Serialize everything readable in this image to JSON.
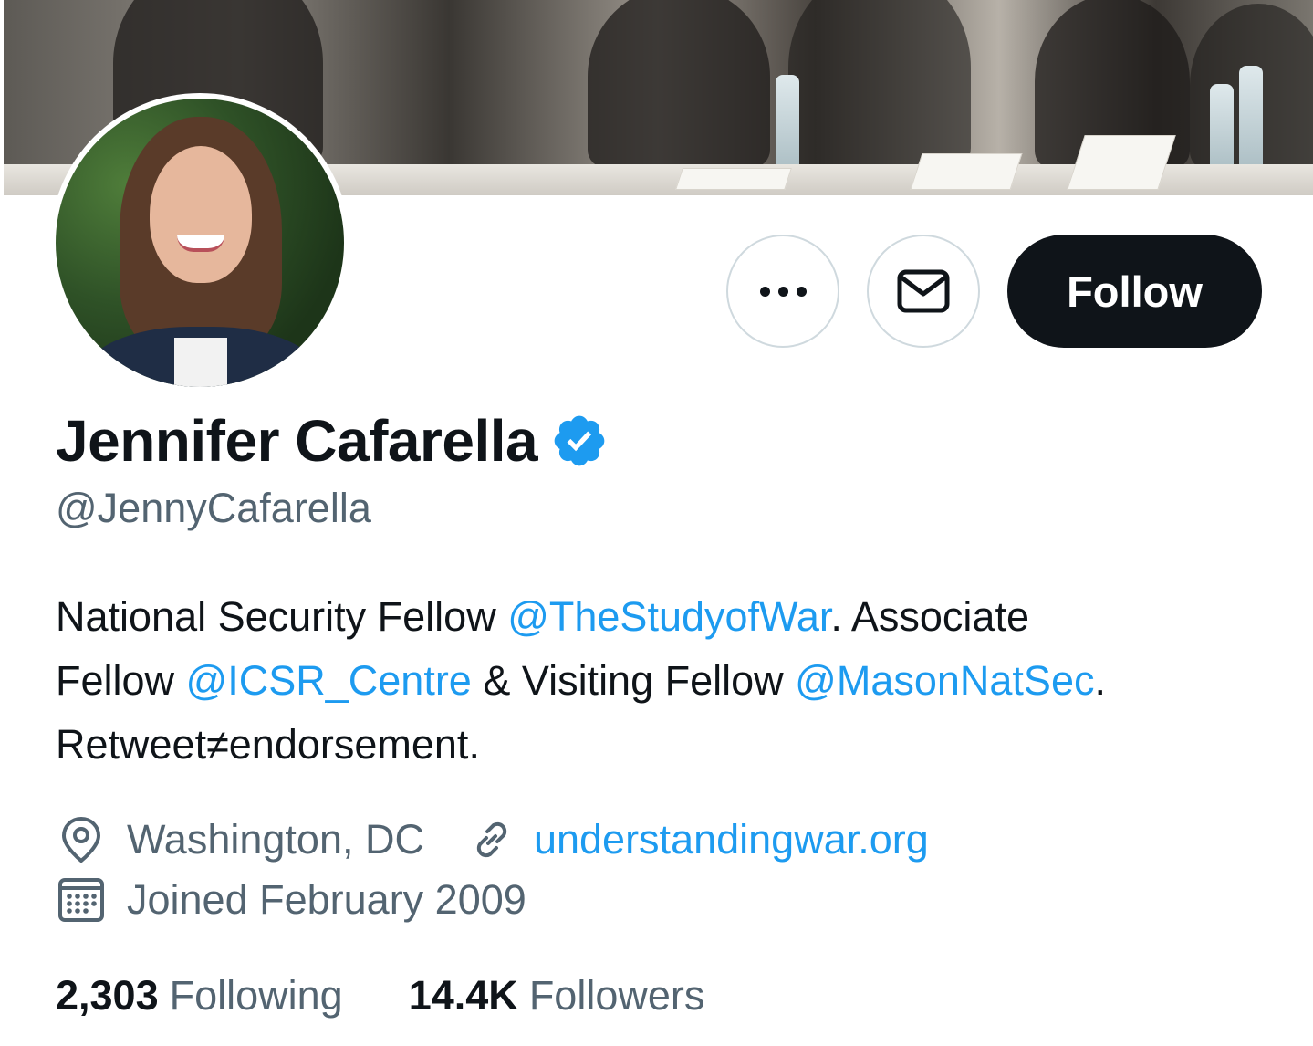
{
  "profile": {
    "display_name": "Jennifer Cafarella",
    "handle": "@JennyCafarella",
    "verified": true,
    "bio": {
      "line1": {
        "text1": "National Security Fellow ",
        "mention1": "@TheStudyofWar",
        "text2": ". Associate"
      },
      "line2": {
        "text1": "Fellow ",
        "mention1": "@ICSR_Centre",
        "text2": " & Visiting Fellow ",
        "mention2": "@MasonNatSec",
        "text3": "."
      },
      "line3": "Retweet≠endorsement."
    },
    "location": "Washington, DC",
    "website": "understandingwar.org",
    "joined": "Joined February 2009",
    "stats": {
      "following_count": "2,303",
      "following_label": "Following",
      "followers_count": "14.4K",
      "followers_label": "Followers"
    }
  },
  "actions": {
    "follow_label": "Follow",
    "more_icon": "more-icon",
    "message_icon": "mail-icon"
  },
  "colors": {
    "accent": "#1d9bf0",
    "text_primary": "#0f1419",
    "text_secondary": "#536471",
    "button_dark": "#0f1419",
    "border": "#cfd9de"
  }
}
